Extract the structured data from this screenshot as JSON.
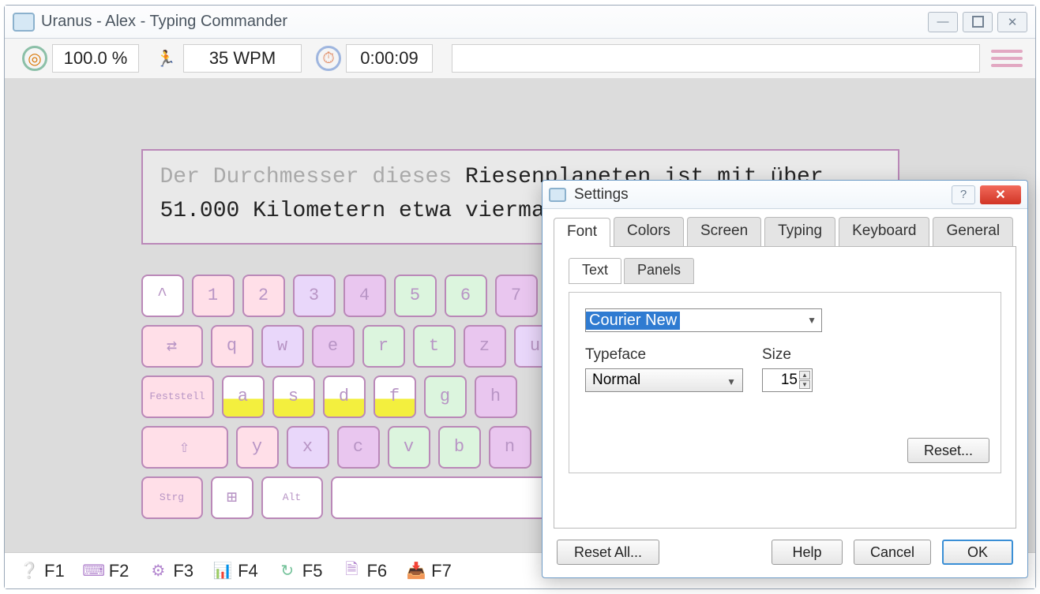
{
  "main": {
    "title": "Uranus - Alex - Typing Commander",
    "accuracy": "100.0 %",
    "wpm": "35 WPM",
    "timer": "0:00:09",
    "typing_typed": "Der Durchmesser dieses ",
    "typing_todo_line1": "Riesenplaneten ist mit über ",
    "typing_line2": "51.000 Kilometern etwa vierma"
  },
  "keyboard": {
    "row1": [
      "^",
      "1",
      "2",
      "3",
      "4",
      "5",
      "6",
      "7"
    ],
    "row2_lead": "⇄",
    "row2": [
      "q",
      "w",
      "e",
      "r",
      "t",
      "z",
      "u"
    ],
    "row3_lead": "Feststell",
    "row3": [
      "a",
      "s",
      "d",
      "f",
      "g",
      "h"
    ],
    "row4_lead": "⇧",
    "row4": [
      "y",
      "x",
      "c",
      "v",
      "b",
      "n"
    ],
    "row5": [
      "Strg",
      "⊞",
      "Alt"
    ]
  },
  "footer": {
    "f1": "F1",
    "f2": "F2",
    "f3": "F3",
    "f4": "F4",
    "f5": "F5",
    "f6": "F6",
    "f7": "F7"
  },
  "settings": {
    "title": "Settings",
    "tabs": [
      "Font",
      "Colors",
      "Screen",
      "Typing",
      "Keyboard",
      "General"
    ],
    "subtabs": [
      "Text",
      "Panels"
    ],
    "font_name": "Courier New",
    "typeface_label": "Typeface",
    "typeface_value": "Normal",
    "size_label": "Size",
    "size_value": "15",
    "reset_btn": "Reset...",
    "reset_all": "Reset All...",
    "help": "Help",
    "cancel": "Cancel",
    "ok": "OK"
  }
}
